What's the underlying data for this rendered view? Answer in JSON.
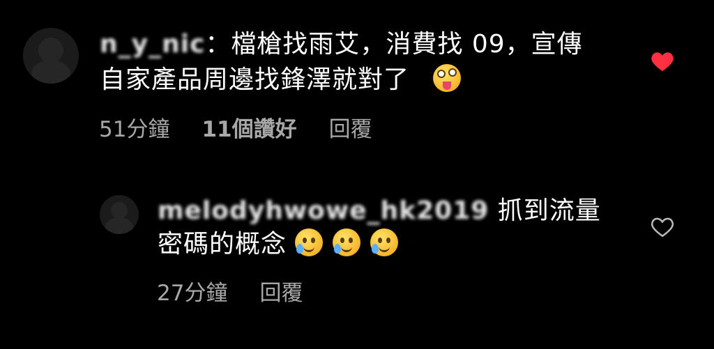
{
  "comments": [
    {
      "username": "n_y_nic",
      "line1": "檔槍找雨艾，消費找 09，宣傳",
      "line2": "自家產品周邊找鋒澤就對了",
      "emojis": [
        "zany-face-emoji"
      ],
      "time": "51分鐘",
      "likes": "11個讚好",
      "reply_label": "回覆",
      "liked": true,
      "heart_color": "#ff3040"
    },
    {
      "username": "melodyhwowe_hk2019",
      "line1": "抓到流量",
      "line2": "密碼的概念",
      "emojis": [
        "face-holding-back-tears-emoji",
        "face-holding-back-tears-emoji",
        "face-holding-back-tears-emoji"
      ],
      "time": "27分鐘",
      "reply_label": "回覆",
      "liked": false
    }
  ]
}
